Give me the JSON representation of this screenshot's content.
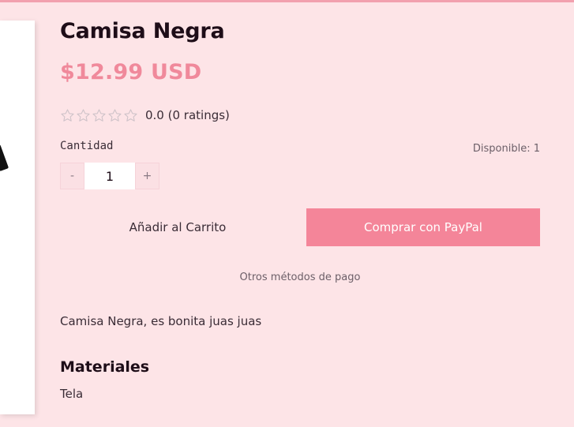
{
  "product": {
    "title": "Camisa Negra",
    "price": "$12.99 USD",
    "rating": {
      "stars_total": 5,
      "stars_filled": 0,
      "text": "0.0 (0 ratings)"
    },
    "quantity": {
      "label": "Cantidad",
      "decrement_label": "-",
      "value": "1",
      "increment_label": "+"
    },
    "availability": "Disponible: 1",
    "actions": {
      "add_to_cart_label": "Añadir al Carrito",
      "paypal_label": "Comprar con PayPal",
      "other_methods_label": "Otros métodos de pago"
    },
    "description": "Camisa Negra, es bonita juas juas",
    "materials": {
      "heading": "Materiales",
      "value": "Tela"
    }
  },
  "colors": {
    "background": "#fde4e7",
    "accent": "#f48599",
    "price": "#f0899b",
    "star_outline": "#cfc3c9"
  }
}
